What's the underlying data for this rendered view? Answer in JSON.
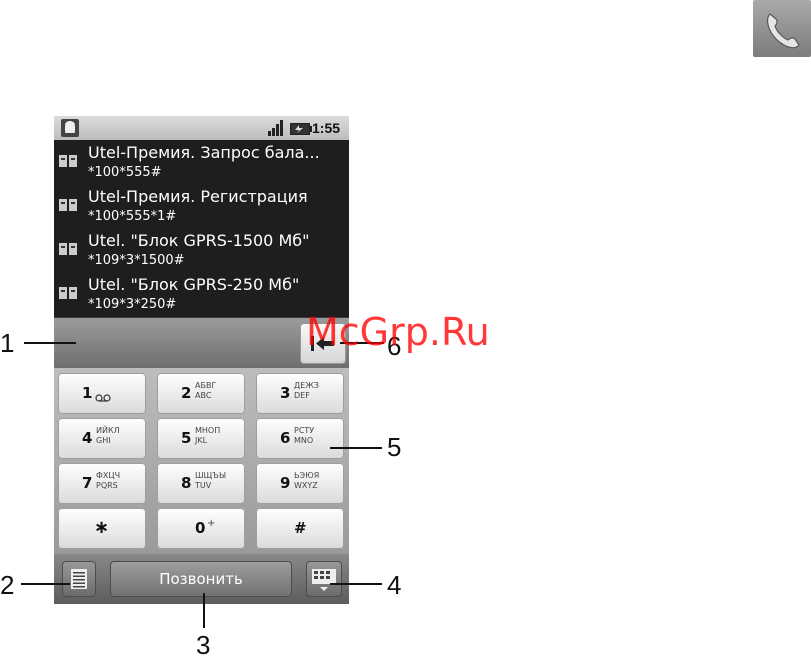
{
  "status_bar": {
    "time": "1:55"
  },
  "suggestions": [
    {
      "name": "Utel-Премия. Запрос бала...",
      "code": "*100*555#"
    },
    {
      "name": "Utel-Премия. Регистрация",
      "code": "*100*555*1#"
    },
    {
      "name": "Utel. \"Блок GPRS-1500 Мб\"",
      "code": "*109*3*1500#"
    },
    {
      "name": "Utel. \"Блок GPRS-250 Мб\"",
      "code": "*109*3*250#"
    }
  ],
  "number_input": {
    "value": ""
  },
  "keypad": [
    {
      "digit": "1",
      "letters": ""
    },
    {
      "digit": "2",
      "letters": "АБВГ\nABC"
    },
    {
      "digit": "3",
      "letters": "ДЕЖЗ\nDEF"
    },
    {
      "digit": "4",
      "letters": "ИЙКЛ\nGHI"
    },
    {
      "digit": "5",
      "letters": "МНОП\nJKL"
    },
    {
      "digit": "6",
      "letters": "РСТУ\nMNO"
    },
    {
      "digit": "7",
      "letters": "ФХЦЧ\nPQRS"
    },
    {
      "digit": "8",
      "letters": "ШЩЪЫ\nTUV"
    },
    {
      "digit": "9",
      "letters": "ЬЭЮЯ\nWXYZ"
    },
    {
      "digit": "∗",
      "letters": ""
    },
    {
      "digit": "0",
      "letters": "+"
    },
    {
      "digit": "#",
      "letters": ""
    }
  ],
  "bottom_bar": {
    "call_label": "Позвонить"
  },
  "callouts": {
    "c1": "1",
    "c2": "2",
    "c3": "3",
    "c4": "4",
    "c5": "5",
    "c6": "6"
  },
  "watermark": "McGrp.Ru",
  "colors": {
    "screen_bg": "#1c1c1c",
    "watermark": "#ff0000",
    "key_face": "#ffffff"
  },
  "icons": [
    "phone-app-icon",
    "android-notification-icon",
    "signal-icon",
    "battery-icon",
    "sim-contact-icon",
    "voicemail-icon",
    "backspace-icon",
    "menu-icon",
    "keyboard-icon"
  ]
}
